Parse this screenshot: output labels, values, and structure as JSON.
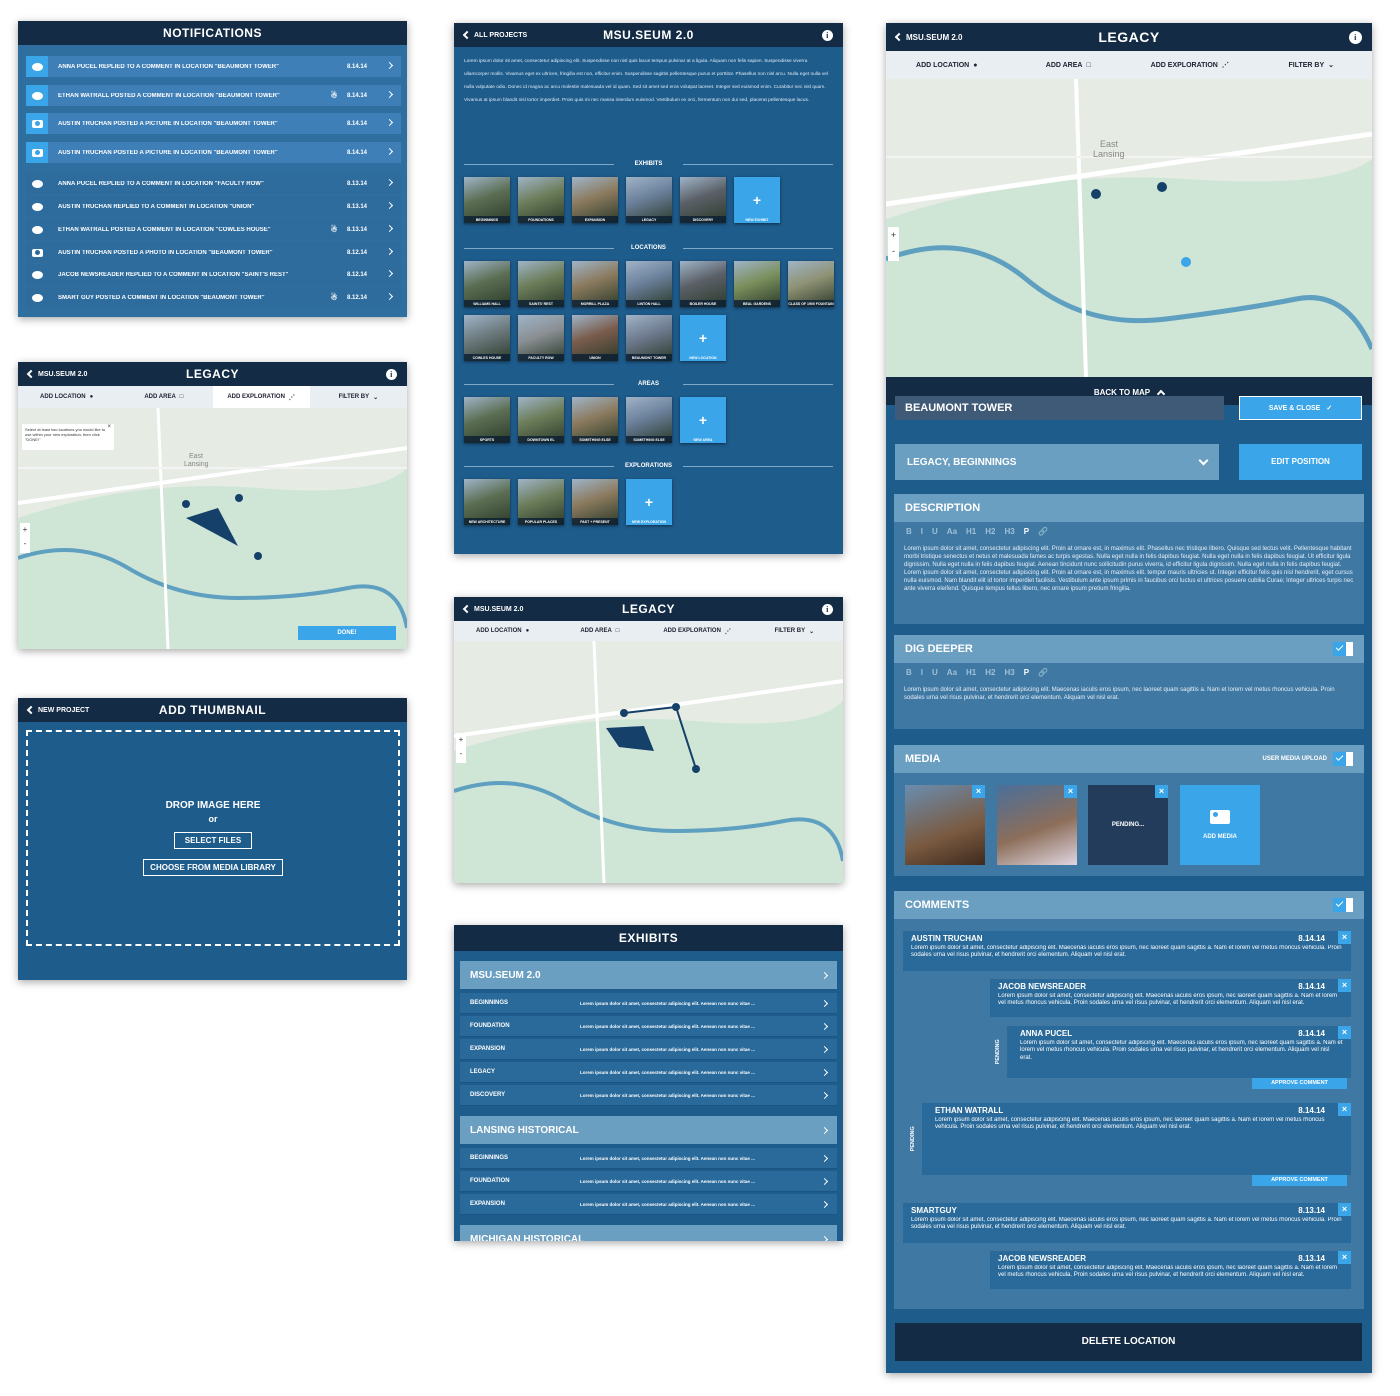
{
  "notifications": {
    "title": "NOTIFICATIONS",
    "items": [
      {
        "text": "ANNA PUCEL REPLIED TO A COMMENT IN LOCATION \"BEAUMONT TOWER\"",
        "date": "8.14.14",
        "icon": "comment-bubble-icon",
        "ghost": false,
        "new": true
      },
      {
        "text": "ETHAN WATRALL POSTED A COMMENT IN LOCATION \"BEAUMONT TOWER\"",
        "date": "8.14.14",
        "icon": "comment-bubble-icon",
        "ghost": true,
        "new": true
      },
      {
        "text": "AUSTIN TRUCHAN POSTED A PICTURE IN LOCATION \"BEAUMONT TOWER\"",
        "date": "8.14.14",
        "icon": "camera-icon",
        "ghost": false,
        "new": true
      },
      {
        "text": "AUSTIN TRUCHAN POSTED A PICTURE IN LOCATION \"BEAUMONT TOWER\"",
        "date": "8.14.14",
        "icon": "camera-icon",
        "ghost": false,
        "new": true
      },
      {
        "text": "ANNA PUCEL REPLIED TO A COMMENT IN LOCATION \"FACULTY ROW\"",
        "date": "8.13.14",
        "icon": "comment-bubble-icon",
        "ghost": false,
        "new": false
      },
      {
        "text": "AUSTIN TRUCHAN REPLIED TO A COMMENT IN LOCATION \"UNION\"",
        "date": "8.13.14",
        "icon": "comment-bubble-icon",
        "ghost": false,
        "new": false
      },
      {
        "text": "ETHAN WATRALL POSTED A COMMENT IN LOCATION \"COWLES HOUSE\"",
        "date": "8.13.14",
        "icon": "comment-bubble-icon",
        "ghost": true,
        "new": false
      },
      {
        "text": "AUSTIN TRUCHAN POSTED A PHOTO IN LOCATION \"BEAUMONT TOWER\"",
        "date": "8.12.14",
        "icon": "camera-icon",
        "ghost": false,
        "new": false
      },
      {
        "text": "JACOB NEWSREADER REPLIED TO A COMMENT IN LOCATION \"SAINT'S REST\"",
        "date": "8.12.14",
        "icon": "comment-bubble-icon",
        "ghost": false,
        "new": false
      },
      {
        "text": "SMART GUY POSTED A COMMENT IN LOCATION \"BEAUMONT TOWER\"",
        "date": "8.12.14",
        "icon": "comment-bubble-icon",
        "ghost": true,
        "new": false
      }
    ]
  },
  "legacy_small": {
    "back": "MSU.SEUM 2.0",
    "title": "LEGACY",
    "toolbar": [
      "ADD LOCATION",
      "ADD AREA",
      "ADD EXPLORATION",
      "FILTER BY"
    ],
    "tooltip": "Select at least two locations you would like to use within your new exploration, then click \"DONE!\"",
    "map_label_1": "East",
    "map_label_2": "Lansing",
    "done": "DONE!"
  },
  "thumbnail": {
    "back": "NEW PROJECT",
    "title": "ADD THUMBNAIL",
    "drop": "DROP IMAGE HERE",
    "or": "or",
    "select": "SELECT FILES",
    "library": "CHOOSE FROM MEDIA LIBRARY"
  },
  "project": {
    "back": "ALL PROJECTS",
    "title": "MSU.SEUM 2.0",
    "intro": "Lorem ipsum dolor sit amet, consectetur adipiscing elit. Suspendisse non nisl quis lacus tempus pulvinar at a ligula. Aliquam non felis sapien. Suspendisse viverra ullamcorper mollis. Vivamus eget ex ultrices, fringilla est non, efficitur enim. Suspendisse sagittis pellentesque purus et porttitor. Phasellus non nisl arcu. Nulla eget nulla vel nulla vulputate odio. Donec id magna ac arcu molestie malesuada vel id quam. Sed sit amet sed eros volutpat laoreet. Integer sed euismod enim. Curabitur nec nisl quam. Vivamus at ipsum blandit nisl tortor imperdiet. Proin quis mi nec massa interdum euismod. Vestibulum ex orci, fermentum non dui sed, placerat pellentesque lacus.",
    "exhibits_label": "EXHIBITS",
    "exhibits": [
      "BEGINNINGS",
      "FOUNDATIONS",
      "EXPANSION",
      "LEGACY",
      "DISCOVERY"
    ],
    "new_exhibit": "NEW EXHIBIT",
    "locations_label": "LOCATIONS",
    "locations": [
      "WILLIAMS HALL",
      "SAINTS' REST",
      "MORRILL PLAZA",
      "LINTON HALL",
      "BOILER HOUSE",
      "BEAL GARDENS",
      "CLASS OF 1900 FOUNTAIN",
      "COWLES HOUSE",
      "FACULTY ROW",
      "UNION",
      "BEAUMONT TOWER"
    ],
    "new_location": "NEW LOCATION",
    "areas_label": "AREAS",
    "areas": [
      "SPORTS",
      "DOWNTOWN EL",
      "SOMETHING ELSE",
      "SOMETHING ELSE"
    ],
    "new_area": "NEW AREA",
    "explorations_label": "EXPLORATIONS",
    "explorations": [
      "NEW ARCHITECTURE",
      "POPULAR PLACES",
      "PAST + PRESENT"
    ],
    "new_exploration": "NEW EXPLORATION"
  },
  "legacy_mid": {
    "back": "MSU.SEUM 2.0",
    "title": "LEGACY",
    "toolbar": [
      "ADD LOCATION",
      "ADD AREA",
      "ADD EXPLORATION",
      "FILTER BY"
    ]
  },
  "exhibits_panel": {
    "title": "EXHIBITS",
    "groups": [
      {
        "name": "MSU.SEUM 2.0",
        "rows": [
          "BEGINNINGS",
          "FOUNDATION",
          "EXPANSION",
          "LEGACY",
          "DISCOVERY"
        ]
      },
      {
        "name": "LANSING HISTORICAL",
        "rows": [
          "BEGINNINGS",
          "FOUNDATION",
          "EXPANSION"
        ]
      },
      {
        "name": "MICHIGAN HISTORICAL",
        "rows": []
      }
    ],
    "row_desc": "Lorem ipsum dolor sit amet, consectetur adipiscing elit. Aenean non nunc vitae ..."
  },
  "editor": {
    "back": "MSU.SEUM 2.0",
    "title": "LEGACY",
    "toolbar": [
      "ADD LOCATION",
      "ADD AREA",
      "ADD EXPLORATION",
      "FILTER BY"
    ],
    "map_label_1": "East",
    "map_label_2": "Lansing",
    "back_to_map": "BACK TO MAP",
    "location_name": "BEAUMONT TOWER",
    "save": "SAVE & CLOSE",
    "exhibits_select": "LEGACY,  BEGINNINGS",
    "edit_position": "EDIT POSITION",
    "description_title": "DESCRIPTION",
    "format_buttons": [
      "B",
      "I",
      "U",
      "Aa",
      "H1",
      "H2",
      "H3",
      "P",
      "🔗"
    ],
    "description": "Lorem ipsum dolor sit amet, consectetur adipiscing elit. Proin at ornare est, in maximus elit. Phasellus nec tristique libero. Quisque sed lectus velit. Pellentesque habitant morbi tristique senectus et netus et malesuada fames ac turpis egestas. Nulla eget nulla in felis dapibus feugiat. Nulla eget nulla in felis dapibus feugiat. Ut efficitur ligula dignissim. Nulla eget nulla in felis dapibus feugiat. Aenean tincidunt nunc sollicitudin purus viverra, id efficitur ligula dignissim. Nulla eget nulla in felis dapibus feugiat. Lorem ipsum dolor sit amet, consectetur adipiscing elit. Proin at ornare est, in maximus elit. tempor mauris ultricies ut. Integer efficitur felis quis nisl hendrerit, eget cursus nulla euismod. Nam blandit elit id tortor imperdiet facilisis. Vestibulum ante ipsum primis in faucibus orci luctus et ultrices posuere cubilia Curae; Integer ultrices turpis nec ante viverra eleifend. Quisque tempus tellus libero, nec ornare ipsum pretium fringilla.",
    "dig_title": "DIG DEEPER",
    "dig_text": "Lorem ipsum dolor sit amet, consectetur adipiscing elit. Maecenas iaculis eros ipsum, nec laoreet quam sagittis a. Nam et lorem vel metus rhoncus vehicula. Proin sodales urna vel risus pulvinar, et hendrerit orci elementum. Aliquam vel nisl erat.",
    "media_title": "MEDIA",
    "media_upload": "USER MEDIA UPLOAD",
    "pending": "PENDING...",
    "add_media": "ADD MEDIA",
    "comments_title": "COMMENTS",
    "comment_text": "Lorem ipsum dolor sit amet, consectetur adipiscing elit. Maecenas iaculis eros ipsum, nec laoreet quam sagittis a. Nam et lorem vel metus rhoncus vehicula. Proin sodales urna vel risus pulvinar, et hendrerit orci elementum. Aliquam vel nisl erat.",
    "comments": [
      {
        "name": "AUSTIN TRUCHAN",
        "date": "8.14.14"
      },
      {
        "name": "JACOB NEWSREADER",
        "date": "8.14.14"
      },
      {
        "name": "ANNA PUCEL",
        "date": "8.14.14"
      },
      {
        "name": "ETHAN WATRALL",
        "date": "8.14.14"
      },
      {
        "name": "SMARTGUY",
        "date": "8.13.14"
      },
      {
        "name": "JACOB NEWSREADER",
        "date": "8.13.14"
      }
    ],
    "pending_label": "PENDING",
    "approve": "APPROVE COMMENT",
    "delete": "DELETE LOCATION"
  }
}
